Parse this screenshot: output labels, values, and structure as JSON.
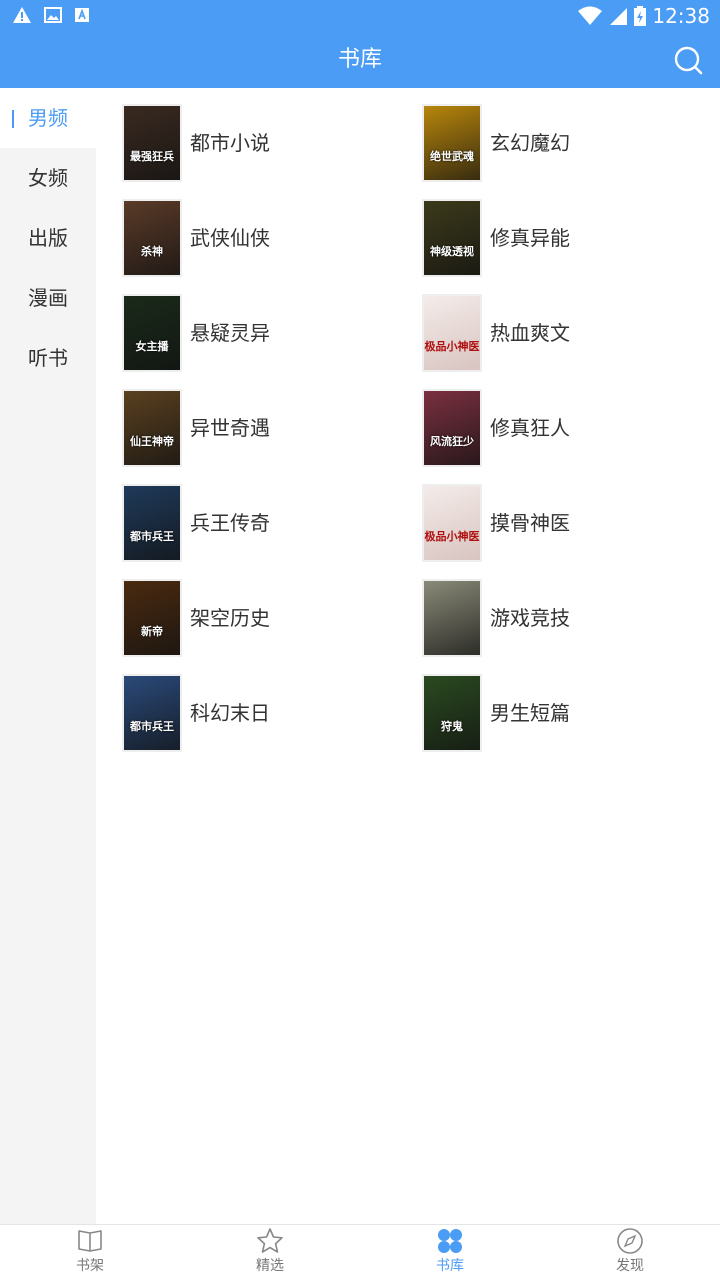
{
  "status_bar": {
    "time": "12:38"
  },
  "app_bar": {
    "title": "书库"
  },
  "sidebar": {
    "items": [
      {
        "label": "男频",
        "active": true
      },
      {
        "label": "女频"
      },
      {
        "label": "出版"
      },
      {
        "label": "漫画"
      },
      {
        "label": "听书"
      }
    ]
  },
  "categories": [
    {
      "label": "都市小说",
      "cover_text": "最强狂兵",
      "cover_color": "#3a2a20"
    },
    {
      "label": "玄幻魔幻",
      "cover_text": "绝世武魂",
      "cover_color": "#b8860b"
    },
    {
      "label": "武侠仙侠",
      "cover_text": "杀神",
      "cover_color": "#5a3a28"
    },
    {
      "label": "修真异能",
      "cover_text": "神级透视",
      "cover_color": "#3c3a1a"
    },
    {
      "label": "悬疑灵异",
      "cover_text": "女主播",
      "cover_color": "#1a2a1a"
    },
    {
      "label": "热血爽文",
      "cover_text": "极品小神医",
      "cover_color": "#e8dcd8"
    },
    {
      "label": "异世奇遇",
      "cover_text": "仙王神帝",
      "cover_color": "#5a4020"
    },
    {
      "label": "修真狂人",
      "cover_text": "风流狂少",
      "cover_color": "#7a3040"
    },
    {
      "label": "兵王传奇",
      "cover_text": "都市兵王",
      "cover_color": "#1f3a5a"
    },
    {
      "label": "摸骨神医",
      "cover_text": "极品小神医",
      "cover_color": "#e8dcd8"
    },
    {
      "label": "架空历史",
      "cover_text": "新帝",
      "cover_color": "#4a2a10"
    },
    {
      "label": "游戏竞技",
      "cover_text": "",
      "cover_color": "#8a8a78"
    },
    {
      "label": "科幻末日",
      "cover_text": "都市兵王",
      "cover_color": "#2a4a7a"
    },
    {
      "label": "男生短篇",
      "cover_text": "狩鬼",
      "cover_color": "#2a4a20"
    }
  ],
  "bottom_nav": {
    "tabs": [
      {
        "label": "书架",
        "icon": "book-icon"
      },
      {
        "label": "精选",
        "icon": "star-icon"
      },
      {
        "label": "书库",
        "icon": "grid-circles-icon",
        "active": true
      },
      {
        "label": "发现",
        "icon": "compass-icon"
      }
    ]
  },
  "colors": {
    "accent": "#4b9cf4",
    "sidebar_bg": "#f4f4f4",
    "text": "#333333"
  }
}
